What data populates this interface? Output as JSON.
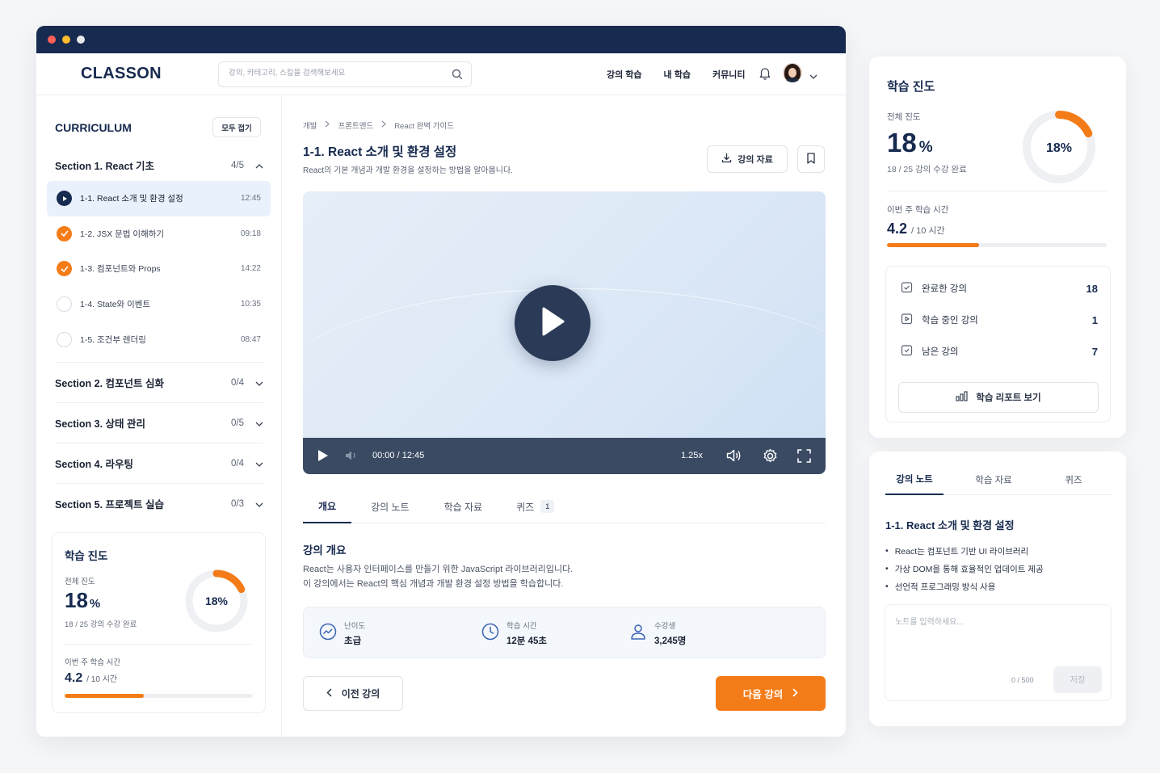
{
  "app": {
    "logo": "CLASSON",
    "search_placeholder": "강의, 카테고리, 스킬을 검색해보세요",
    "nav": [
      "강의 학습",
      "내 학습",
      "커뮤니티"
    ]
  },
  "sidebar": {
    "title": "CURRICULUM",
    "collapse_all": "모두 접기",
    "section1": {
      "label": "Section 1. React 기초",
      "count": "4/5"
    },
    "lessons": [
      {
        "title": "1-1. React 소개 및 환경 설정",
        "duration": "12:45",
        "status": "playing"
      },
      {
        "title": "1-2. JSX 문법 이해하기",
        "duration": "09:18",
        "status": "done"
      },
      {
        "title": "1-3. 컴포넌트와 Props",
        "duration": "14:22",
        "status": "done"
      },
      {
        "title": "1-4. State와 이벤트",
        "duration": "10:35",
        "status": "todo"
      },
      {
        "title": "1-5. 조건부 렌더링",
        "duration": "08:47",
        "status": "todo"
      }
    ],
    "sections": [
      {
        "label": "Section 2. 컴포넌트 심화",
        "count": "0/4"
      },
      {
        "label": "Section 3. 상태 관리",
        "count": "0/5"
      },
      {
        "label": "Section 4. 라우팅",
        "count": "0/4"
      },
      {
        "label": "Section 5. 프로젝트 실습",
        "count": "0/3"
      }
    ]
  },
  "progress": {
    "title": "학습 진도",
    "overall_label": "전체 진도",
    "percent_number": "18",
    "percent_unit": "%",
    "percent_text": "18%",
    "percent_value": 0.18,
    "completed_text": "18 / 25 강의 수강 완료",
    "week_label": "이번 주 학습 시간",
    "week_hours": "4.2",
    "week_total": "/ 10 시간",
    "week_fraction": 0.42
  },
  "main": {
    "breadcrumb": [
      "개발",
      "프론트엔드",
      "React 완벽 가이드"
    ],
    "title": "1-1. React 소개 및 환경 설정",
    "subtitle": "React의 기본 개념과 개발 환경을 설정하는 방법을 알아봅니다.",
    "materials_button": "강의 자료",
    "video": {
      "time": "00:00 / 12:45",
      "speed": "1.25x"
    },
    "tabs": [
      {
        "label": "개요"
      },
      {
        "label": "강의 노트"
      },
      {
        "label": "학습 자료"
      },
      {
        "label": "퀴즈",
        "badge": "1"
      }
    ],
    "overview_title": "강의 개요",
    "overview_lines": [
      "React는 사용자 인터페이스를 만들기 위한 JavaScript 라이브러리입니다.",
      "이 강의에서는 React의 핵심 개념과 개발 환경 설정 방법을 학습합니다."
    ],
    "info": [
      {
        "label": "난이도",
        "value": "초급"
      },
      {
        "label": "학습 시간",
        "value": "12분 45초"
      },
      {
        "label": "수강생",
        "value": "3,245명"
      }
    ],
    "prev_button": "이전 강의",
    "next_button": "다음 강의"
  },
  "stats": [
    {
      "label": "완료한 강의",
      "value": "18"
    },
    {
      "label": "학습 중인 강의",
      "value": "1"
    },
    {
      "label": "남은 강의",
      "value": "7"
    }
  ],
  "report_button": "학습 리포트 보기",
  "notes": {
    "tabs": [
      "강의 노트",
      "학습 자료",
      "퀴즈"
    ],
    "title": "1-1. React 소개 및 환경 설정",
    "items": [
      "React는 컴포넌트 기반 UI 라이브러리",
      "가상 DOM을 통해 효율적인 업데이트 제공",
      "선언적 프로그래밍 방식 사용"
    ],
    "placeholder": "노트를 입력하세요...",
    "count": "0 / 500",
    "save": "저장"
  },
  "colors": {
    "navy": "#172a4f",
    "accent": "#f47c18"
  }
}
